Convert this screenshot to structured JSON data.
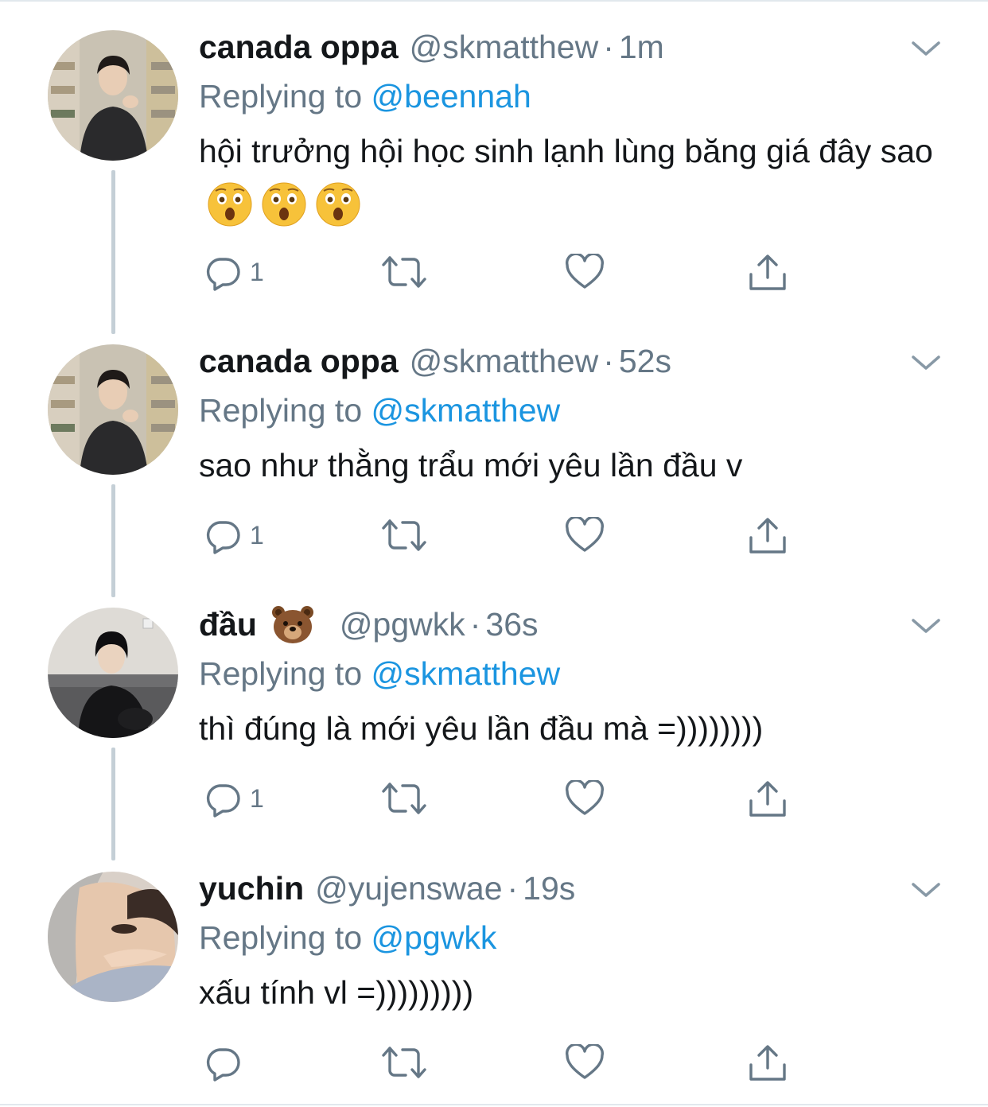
{
  "tweets": [
    {
      "display_name": "canada oppa",
      "handle": "@skmatthew",
      "separator": "·",
      "time": "1m",
      "replying_label": "Replying to",
      "replying_to": "@beennah",
      "text": "hội trưởng hội học sinh lạnh lùng băng giá đây sao",
      "text_emoji": "astonished-face x3",
      "reply_count": "1",
      "avatar": "avatar-photo-standing"
    },
    {
      "display_name": "canada oppa",
      "handle": "@skmatthew",
      "separator": "·",
      "time": "52s",
      "replying_label": "Replying to",
      "replying_to": "@skmatthew",
      "text": "sao như thằng trẩu mới yêu lần đầu v",
      "reply_count": "1",
      "avatar": "avatar-photo-standing"
    },
    {
      "display_name": "đầu",
      "name_emoji": "bear-face",
      "handle": "@pgwkk",
      "separator": "·",
      "time": "36s",
      "replying_label": "Replying to",
      "replying_to": "@skmatthew",
      "text": "thì đúng là mới yêu lần đầu mà =))))))))",
      "reply_count": "1",
      "avatar": "avatar-photo-sofa"
    },
    {
      "display_name": "yuchin",
      "handle": "@yujenswae",
      "separator": "·",
      "time": "19s",
      "replying_label": "Replying to",
      "replying_to": "@pgwkk",
      "text": "xấu tính vl =)))))))))",
      "reply_count": "",
      "avatar": "avatar-photo-closeup"
    }
  ],
  "icons": {
    "reply": "reply-icon",
    "retweet": "retweet-icon",
    "like": "like-icon",
    "share": "share-icon",
    "caret": "chevron-down-icon"
  },
  "colors": {
    "link": "#1b95e0",
    "secondary_text": "#657786",
    "primary_text": "#14171a",
    "thread_line": "#c4cfd6"
  }
}
